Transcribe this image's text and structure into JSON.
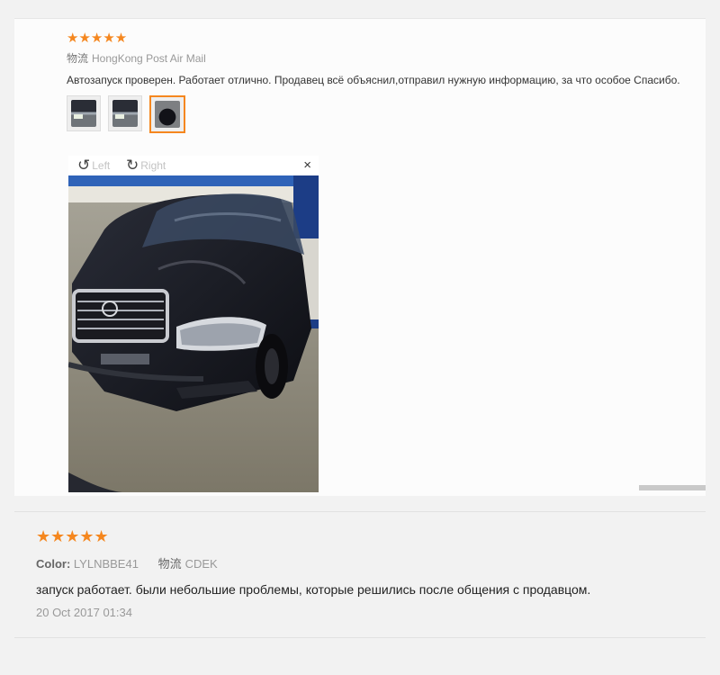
{
  "review1": {
    "stars": "★★★★★",
    "shipping_label": "物流",
    "shipping_value": "HongKong Post Air Mail",
    "text": "Автозапуск проверен. Работает отлично. Продавец всё объяснил,отправил нужную информацию, за что особое Спасибо.",
    "thumbnails": [
      "photo-1",
      "photo-2",
      "photo-3"
    ],
    "viewer": {
      "rotate_left_label": "Left",
      "rotate_right_label": "Right",
      "close_glyph": "×"
    }
  },
  "review2": {
    "stars": "★★★★★",
    "color_label": "Color:",
    "color_value": "LYLNBBE41",
    "shipping_label": "物流",
    "shipping_value": "CDEK",
    "text": "запуск работает. были небольшие проблемы, которые решились после общения с продавцом.",
    "date": "20 Oct 2017 01:34"
  },
  "colors": {
    "star": "#f5871f",
    "selected_border": "#f5871f"
  }
}
